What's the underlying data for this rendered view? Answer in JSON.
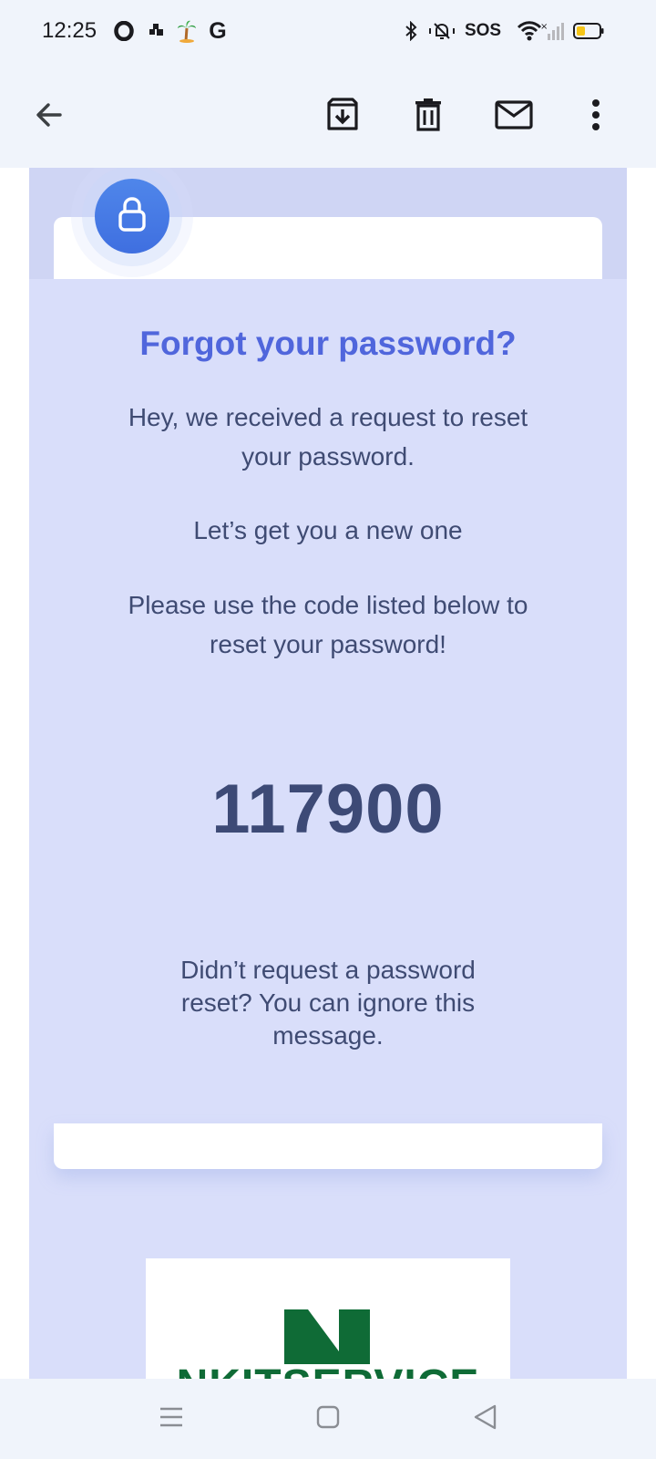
{
  "status_bar": {
    "time": "12:25",
    "left_icons": [
      "opera-icon",
      "puzzle-icon",
      "palm-tree-icon",
      "google-icon"
    ],
    "google_letter": "G",
    "sos": "SOS",
    "right_icons": [
      "bluetooth-icon",
      "mute-icon",
      "sos-text",
      "wifi-icon",
      "signal-icon",
      "battery-icon"
    ],
    "battery_color": "#f5c518"
  },
  "app_bar": {
    "icons": [
      "back-arrow-icon",
      "archive-icon",
      "delete-icon",
      "mark-unread-icon",
      "more-options-icon"
    ]
  },
  "email": {
    "title": "Forgot your password?",
    "para1": "Hey, we received a request to reset your password.",
    "para2": "Let’s get you a new one",
    "para3": "Please use the code listed below to reset your password!",
    "code": "117900",
    "para4": "Didn’t request a password reset? You can ignore this message.",
    "logo_text": "NKITSERVICE",
    "colors": {
      "title": "#5066dc",
      "body_text": "#3f4b73",
      "email_background": "#d9defa",
      "lock_badge": "#4a7de6",
      "logo_green": "#0f6b36"
    }
  },
  "nav_bar": {
    "icons": [
      "recent-apps-icon",
      "home-icon",
      "back-triangle-icon"
    ]
  }
}
